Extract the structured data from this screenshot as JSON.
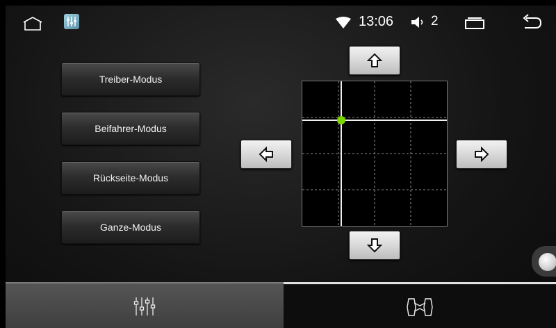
{
  "status_bar": {
    "time": "13:06",
    "volume_level": "2",
    "icons": [
      "home-icon",
      "equalizer-app-icon",
      "wifi-icon",
      "volume-icon",
      "recent-apps-icon",
      "back-icon"
    ]
  },
  "modes": [
    {
      "label": "Treiber-Modus"
    },
    {
      "label": "Beifahrer-Modus"
    },
    {
      "label": "Rückseite-Modus"
    },
    {
      "label": "Ganze-Modus"
    }
  ],
  "balance": {
    "position_x": -0.5,
    "position_y": 0.5,
    "marker_color": "#7cd400"
  },
  "tabs": [
    {
      "name": "equalizer",
      "icon": "equalizer-sliders-icon",
      "selected": false
    },
    {
      "name": "fader-balance",
      "icon": "car-seats-icon",
      "selected": true
    }
  ],
  "colors": {
    "accent_marker": "#7cd400",
    "tab_indicator": "#e0e0e0"
  }
}
